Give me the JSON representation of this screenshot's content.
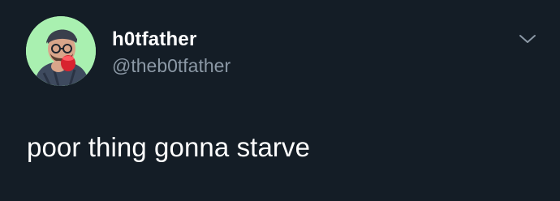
{
  "tweet": {
    "display_name": "h0tfather",
    "handle": "@theb0tfather",
    "text": "poor thing gonna starve"
  },
  "icons": {
    "avatar": "user-avatar-photo",
    "caret": "chevron-down-icon"
  },
  "colors": {
    "background": "#141d26",
    "primary_text": "#ffffff",
    "secondary_text": "#8b98a5",
    "avatar_bg": "#a9f0b0"
  }
}
